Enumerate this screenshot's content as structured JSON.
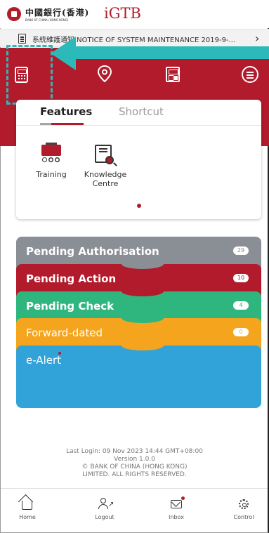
{
  "header": {
    "brand_cn": "中國銀行(香港)",
    "brand_en": "BANK OF CHINA (HONG KONG)",
    "igtb_logo": "iGTB"
  },
  "notice": {
    "text": "系統維護通知 NOTICE OF SYSTEM MAINTENANCE 2019-9-..."
  },
  "nav_icons": [
    "calculator-icon",
    "location-pin-icon",
    "layout-icon",
    "menu-icon"
  ],
  "tabs": {
    "features": "Features",
    "shortcut": "Shortcut"
  },
  "features": [
    {
      "label": "Training"
    },
    {
      "label_line1": "Knowledge",
      "label_line2": "Centre"
    }
  ],
  "pending": {
    "authorisation": {
      "label": "Pending Authorisation",
      "count": "29"
    },
    "action": {
      "label": "Pending Action",
      "count": "10"
    },
    "check": {
      "label": "Pending Check",
      "count": "4"
    },
    "forward": {
      "label": "Forward-dated",
      "count": "0"
    },
    "alert": {
      "label": "e-Alert"
    }
  },
  "footer": {
    "last_login": "Last Login: 09 Nov 2023 14:44 GMT+08:00",
    "version": "Version 1.0.0",
    "copyright_line1": "© BANK OF CHINA (HONG KONG)",
    "copyright_line2": "LIMITED. ALL RIGHTS RESERVED."
  },
  "bottom_nav": {
    "home": "Home",
    "logout": "Logout",
    "inbox": "Inbox",
    "control": "Control"
  },
  "colors": {
    "brand_red": "#b21b2b",
    "annotation_teal": "#2cb9b9",
    "authorisation_grey": "#8a8e95",
    "check_green": "#2fb67e",
    "forward_orange": "#f5a51d",
    "alert_blue": "#32a3d9"
  }
}
